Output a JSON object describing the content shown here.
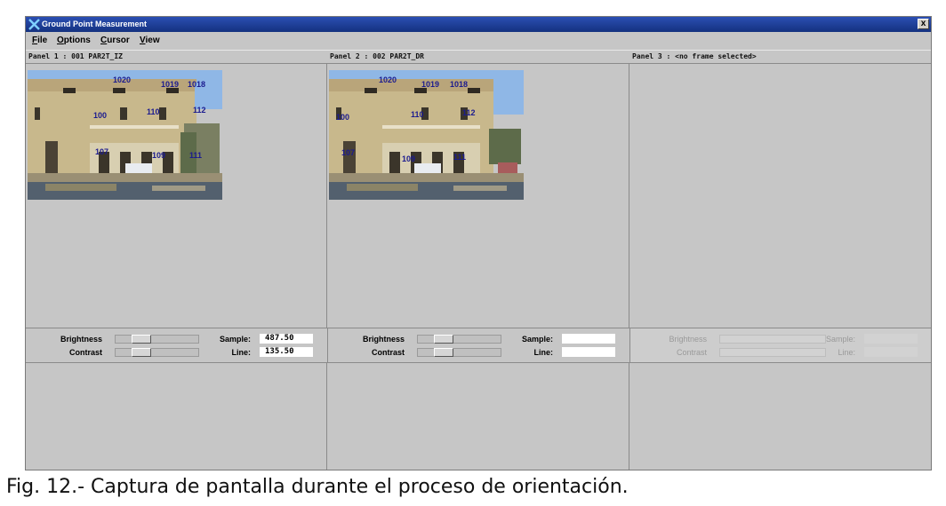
{
  "window": {
    "title": "Ground Point Measurement",
    "close_glyph": "x"
  },
  "menu": [
    {
      "label": "File"
    },
    {
      "label": "Options"
    },
    {
      "label": "Cursor"
    },
    {
      "label": "View"
    }
  ],
  "panels": [
    {
      "header": "Panel 1 : 001 PAR2T_IZ",
      "point_labels": [
        "1020",
        "1019",
        "1018",
        "100",
        "110",
        "112",
        "107",
        "109",
        "111"
      ],
      "controls": {
        "brightness_label": "Brightness",
        "contrast_label": "Contrast",
        "sample_label": "Sample:",
        "line_label": "Line:",
        "sample_value": "487.50",
        "line_value": "135.50"
      }
    },
    {
      "header": "Panel 2 : 002 PAR2T_DR",
      "point_labels": [
        "1020",
        "1019",
        "1018",
        "100",
        "110",
        "112",
        "107",
        "109",
        "111"
      ],
      "controls": {
        "brightness_label": "Brightness",
        "contrast_label": "Contrast",
        "sample_label": "Sample:",
        "line_label": "Line:",
        "sample_value": "",
        "line_value": ""
      }
    },
    {
      "header": "Panel 3 : <no frame selected>",
      "controls": {
        "brightness_label": "Brightness",
        "contrast_label": "Contrast",
        "sample_label": "Sample:",
        "line_label": "Line:",
        "sample_value": "",
        "line_value": ""
      }
    }
  ],
  "caption": "Fig. 12.- Captura de pantalla durante el proceso de orientación.",
  "colors": {
    "titlebar": "#1f3f9a",
    "window_bg": "#c6c6c6",
    "point_label": "#1b1b8f"
  },
  "icons": {
    "app": "app-x-icon",
    "close": "close-icon"
  }
}
